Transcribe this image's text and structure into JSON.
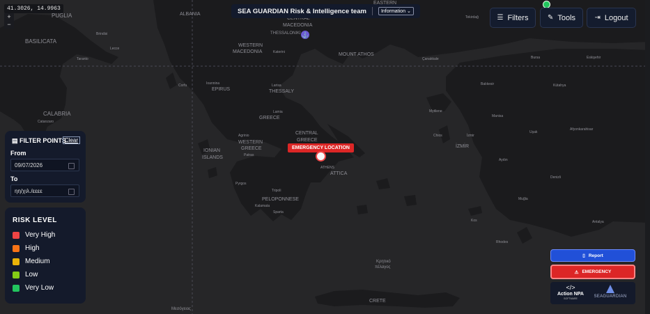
{
  "coordinates": "41.3026, 14.9963",
  "zoom": {
    "in": "+",
    "out": "−"
  },
  "header": {
    "title": "SEA GUARDIAN Risk & Intelligence team",
    "select_value": "Information"
  },
  "toolbar": {
    "filters": "Filters",
    "tools": "Tools",
    "logout": "Logout"
  },
  "filter_points": {
    "title": "FILTER POINTS",
    "clear": "Clear",
    "from_label": "From",
    "from_value": "09/07/2026",
    "to_label": "To",
    "to_value": "ηη/χιλ./εεεε"
  },
  "risk_level": {
    "title": "RISK LEVEL",
    "items": [
      {
        "label": "Very High",
        "color": "#ef4444"
      },
      {
        "label": "High",
        "color": "#f97316"
      },
      {
        "label": "Medium",
        "color": "#eab308"
      },
      {
        "label": "Low",
        "color": "#84cc16"
      },
      {
        "label": "Very Low",
        "color": "#22c55e"
      }
    ]
  },
  "actions": {
    "report": "Report",
    "emergency": "EMERGENCY"
  },
  "logos": {
    "action": "Action NPA",
    "action_sub": "SOFTWARE",
    "sea": "SEAGUARDIAN"
  },
  "emergency_marker": "EMERGENCY LOCATION",
  "map_labels": {
    "albania": "ALBANIA",
    "puglia": "PUGLIA",
    "basilicata": "BASILICATA",
    "calabria": "CALABRIA",
    "brindisi": "Brindisi",
    "lecce": "Lecce",
    "taranto": "Taranto",
    "catanzaro": "Catanzaro",
    "central_macedonia_1": "CENTRAL",
    "central_macedonia_2": "MACEDONIA",
    "thessaloniki": "THESSALONIKI",
    "western_macedonia_1": "WESTERN",
    "western_macedonia_2": "MACEDONIA",
    "katerini": "Katerini",
    "mount_athos": "MOUNT ATHOS",
    "eastern": "EASTERN",
    "ioannina": "Ioannina",
    "epirus": "EPIRUS",
    "larisa": "Larisa",
    "thessaly": "THESSALY",
    "corfu": "Corfu",
    "greece": "GREECE",
    "lamia": "Lamia",
    "central_greece_1": "CENTRAL",
    "central_greece_2": "GREECE",
    "western_greece_1": "WESTERN",
    "western_greece_2": "GREECE",
    "ionian_1": "IONIAN",
    "ionian_2": "ISLANDS",
    "agrinio": "Agrinio",
    "patras": "Patras",
    "athens": "ATHENS",
    "attica": "ATTICA",
    "pyrgos": "Pyrgos",
    "tripoli": "Tripoli",
    "peloponnese": "PELOPONNESE",
    "sparta": "Sparta",
    "kalamata": "Kalamata",
    "kritiko_1": "Κρητικό",
    "kritiko_2": "πέλαγος",
    "crete": "CRETE",
    "mesogeios": "Μεσόγειος",
    "tekirdag": "Tekirdağ",
    "canakkale": "Çanakkale",
    "balikesir": "Balıkesir",
    "bursa": "Bursa",
    "eskisehir": "Eskişehir",
    "kutahya": "Kütahya",
    "manisa": "Manisa",
    "izmir": "İZMİR",
    "izmir_city": "İzmir",
    "usak": "Uşak",
    "afyon": "Afyonkarahisar",
    "mytilene": "Mytilene",
    "aydin": "Aydın",
    "denizli": "Denizli",
    "mugla": "Muğla",
    "antalya": "Antalya",
    "rhodes": "Rhodes",
    "kos": "Kos",
    "chios": "Chios"
  }
}
